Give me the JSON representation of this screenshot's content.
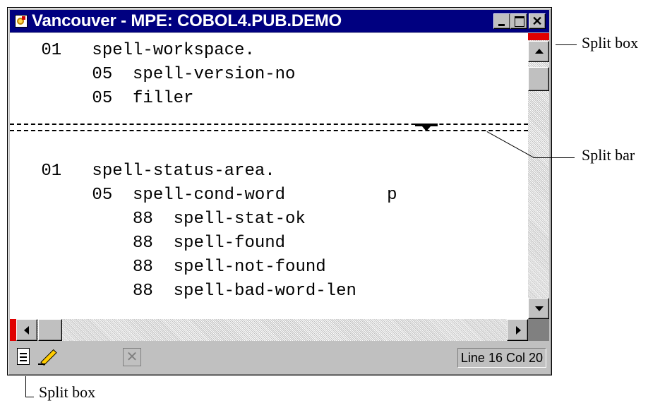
{
  "window": {
    "title": "Vancouver - MPE: COBOL4.PUB.DEMO",
    "buttons": {
      "minimize": "",
      "maximize": "",
      "close": "✕"
    }
  },
  "editor": {
    "top_pane_lines": [
      " 01   spell-workspace.",
      "      05  spell-version-no",
      "      05  filler"
    ],
    "bottom_pane_lines": [
      " 01   spell-status-area.",
      "      05  spell-cond-word          p",
      "          88  spell-stat-ok",
      "          88  spell-found",
      "          88  spell-not-found",
      "          88  spell-bad-word-len"
    ]
  },
  "statusbar": {
    "position": "Line 16 Col 20",
    "icons": [
      "document-icon",
      "pencil-icon",
      "cancel-icon"
    ]
  },
  "callouts": {
    "split_box_top": "Split box",
    "split_bar": "Split bar",
    "split_box_bottom": "Split box"
  },
  "colors": {
    "titlebar": "#000080",
    "split_box": "#e00000",
    "window_face": "#c0c0c0"
  }
}
